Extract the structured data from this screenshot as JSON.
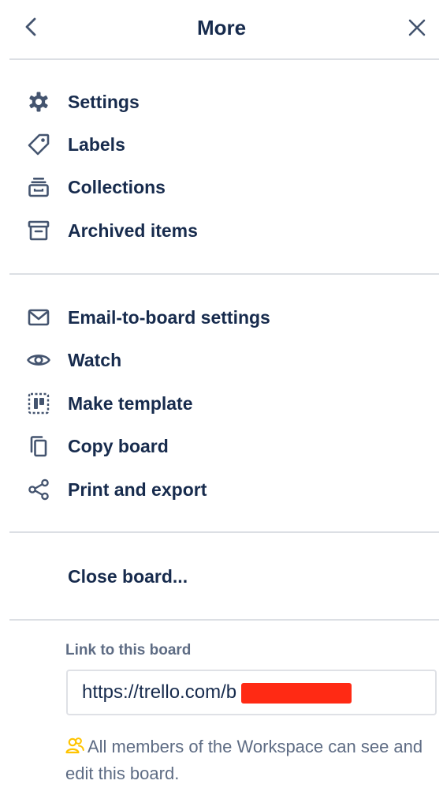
{
  "header": {
    "title": "More",
    "back_icon": "chevron-left-icon",
    "close_icon": "close-icon"
  },
  "sections": [
    {
      "items": [
        {
          "label": "Settings",
          "icon": "gear-icon"
        },
        {
          "label": "Labels",
          "icon": "tag-icon"
        },
        {
          "label": "Collections",
          "icon": "collections-icon"
        },
        {
          "label": "Archived items",
          "icon": "archive-icon"
        }
      ]
    },
    {
      "items": [
        {
          "label": "Email-to-board settings",
          "icon": "email-icon"
        },
        {
          "label": "Watch",
          "icon": "eye-icon"
        },
        {
          "label": "Make template",
          "icon": "template-icon"
        },
        {
          "label": "Copy board",
          "icon": "copy-icon"
        },
        {
          "label": "Print and export",
          "icon": "share-icon"
        }
      ]
    },
    {
      "items": [
        {
          "label": "Close board..."
        }
      ]
    }
  ],
  "link": {
    "label": "Link to this board",
    "value": "https://trello.com/b"
  },
  "note": {
    "icon": "workspace-members-icon",
    "text": "All members of the Workspace can see and edit this board."
  },
  "colors": {
    "text": "#172b4d",
    "muted": "#5e6c84",
    "divider": "#dcdfe4",
    "warning": "#ffc400",
    "redaction": "#ff2a14"
  }
}
